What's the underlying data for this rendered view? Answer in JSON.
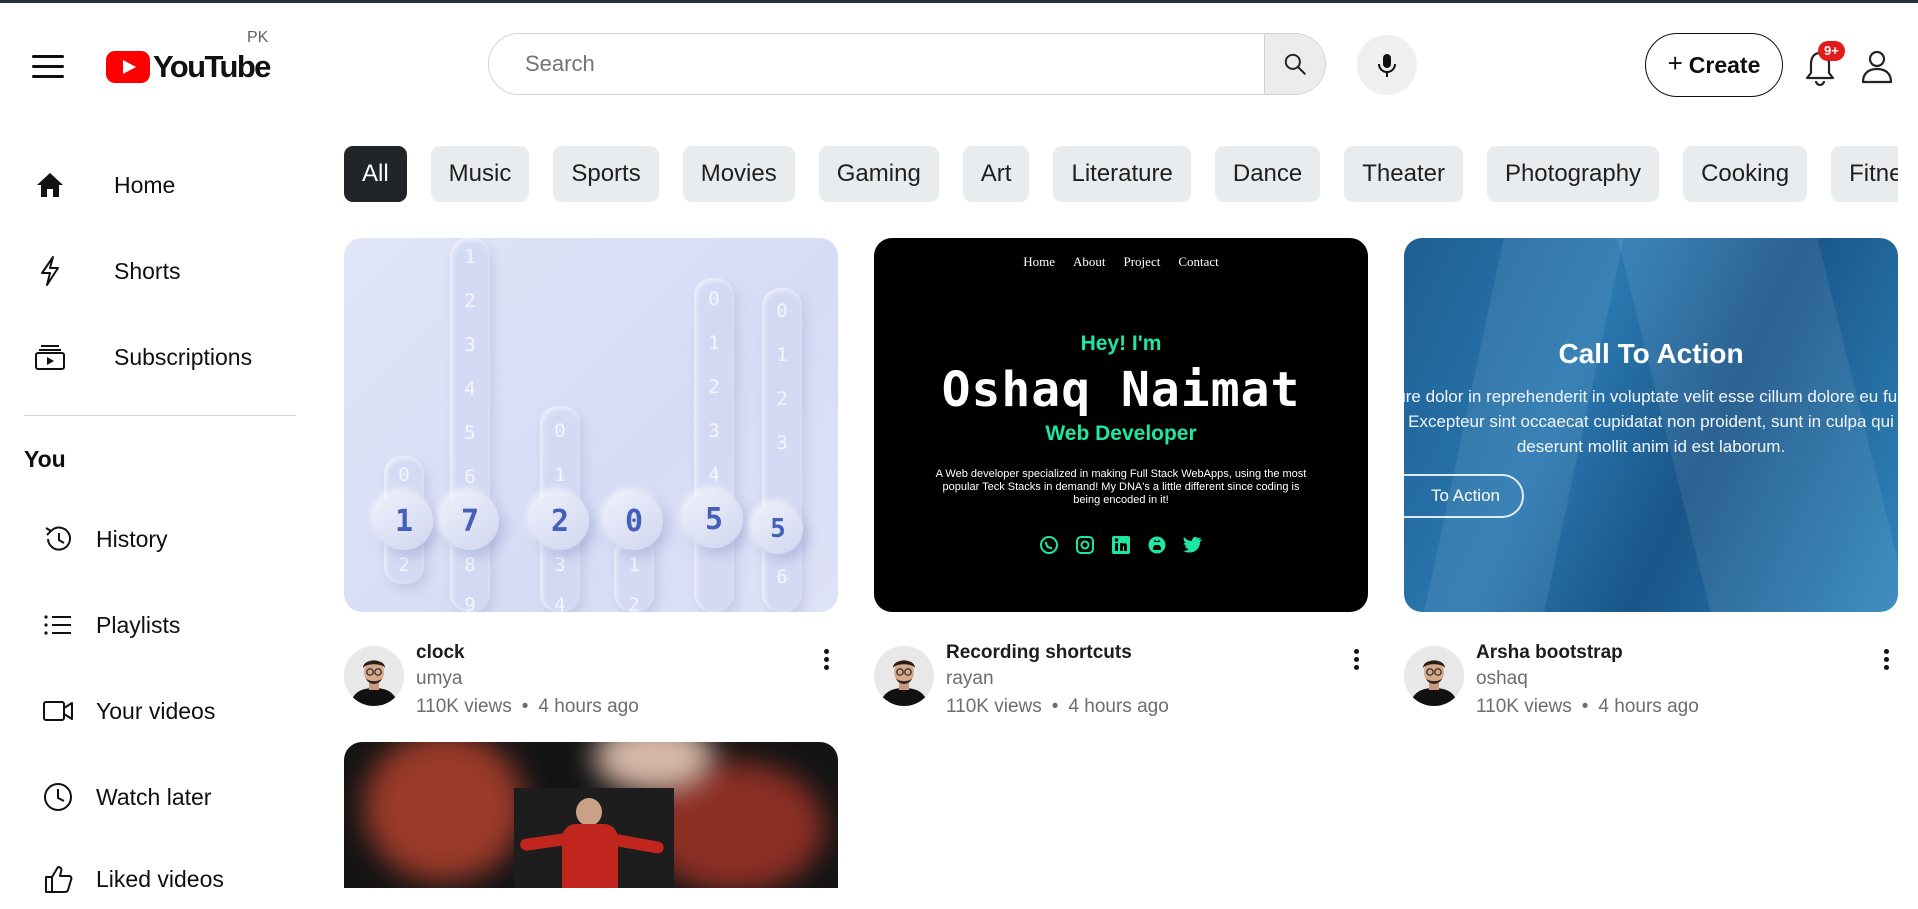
{
  "header": {
    "logo_text": "YouTube",
    "country": "PK",
    "search_placeholder": "Search",
    "create_label": "Create",
    "create_plus": "+",
    "notifications_badge": "9+"
  },
  "sidebar": {
    "main_items": [
      {
        "label": "Home",
        "icon": "home-icon"
      },
      {
        "label": "Shorts",
        "icon": "shorts-icon"
      },
      {
        "label": "Subscriptions",
        "icon": "subscriptions-icon"
      }
    ],
    "you_label": "You",
    "you_items": [
      {
        "label": "History",
        "icon": "history-icon"
      },
      {
        "label": "Playlists",
        "icon": "playlists-icon"
      },
      {
        "label": "Your videos",
        "icon": "your-videos-icon"
      },
      {
        "label": "Watch later",
        "icon": "watch-later-icon"
      },
      {
        "label": "Liked videos",
        "icon": "liked-videos-icon"
      }
    ]
  },
  "chips": [
    "All",
    "Music",
    "Sports",
    "Movies",
    "Gaming",
    "Art",
    "Literature",
    "Dance",
    "Theater",
    "Photography",
    "Cooking",
    "Fitness"
  ],
  "videos": [
    {
      "title": "clock",
      "channel": "umya",
      "views": "110K views",
      "age": "4 hours ago"
    },
    {
      "title": "Recording shortcuts",
      "channel": "rayan",
      "views": "110K views",
      "age": "4 hours ago"
    },
    {
      "title": "Arsha bootstrap",
      "channel": "oshaq",
      "views": "110K views",
      "age": "4 hours ago"
    }
  ],
  "thumb_clock": {
    "digits": [
      "1",
      "7",
      "2",
      "0",
      "5",
      "5"
    ],
    "ghost_digits": [
      "0",
      "2",
      "1",
      "2",
      "3",
      "4",
      "5",
      "6",
      "8",
      "9",
      "0",
      "1",
      "3",
      "4",
      "0",
      "1",
      "2",
      "0",
      "1",
      "2",
      "3",
      "4",
      "0",
      "1",
      "2",
      "3",
      "6"
    ]
  },
  "thumb_portfolio": {
    "nav": [
      "Home",
      "About",
      "Project",
      "Contact"
    ],
    "greeting": "Hey! I'm",
    "name": "Oshaq Naimat",
    "role": "Web Developer",
    "description": "A Web developer specialized in making Full Stack WebApps, using the most popular Teck Stacks in demand! My DNA's a little different since coding is being encoded in it!",
    "accent": "#1ee6a4"
  },
  "thumb_arsha": {
    "title": "Call To Action",
    "text": "rure dolor in reprehenderit in voluptate velit esse cillum dolore eu fu r. Excepteur sint occaecat cupidatat non proident, sunt in culpa qui deserunt mollit anim id est laborum.",
    "button": "To Action"
  },
  "colors": {
    "brand_red": "#ff0000",
    "chip_active": "#212529",
    "chip_bg": "#e9ecef",
    "badge": "#e21b1b"
  }
}
